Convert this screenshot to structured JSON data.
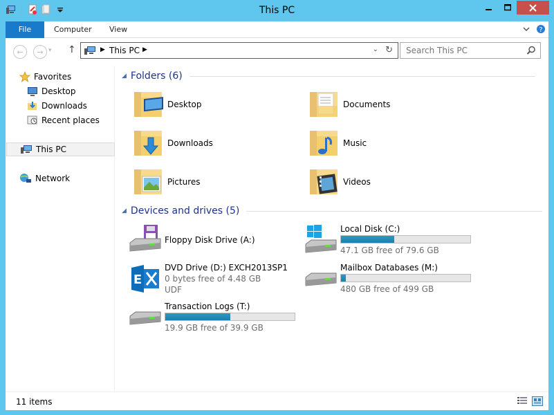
{
  "window": {
    "title": "This PC"
  },
  "ribbon": {
    "tabs": [
      "File",
      "Computer",
      "View"
    ]
  },
  "address": {
    "crumb": "This PC"
  },
  "search": {
    "placeholder": "Search This PC"
  },
  "nav": {
    "favorites": "Favorites",
    "items": [
      "Desktop",
      "Downloads",
      "Recent places"
    ],
    "this_pc": "This PC",
    "network": "Network"
  },
  "folders": {
    "header": "Folders (6)",
    "items": [
      {
        "name": "Desktop",
        "icon": "folder-desktop-icon"
      },
      {
        "name": "Documents",
        "icon": "folder-documents-icon"
      },
      {
        "name": "Downloads",
        "icon": "folder-downloads-icon"
      },
      {
        "name": "Music",
        "icon": "folder-music-icon"
      },
      {
        "name": "Pictures",
        "icon": "folder-pictures-icon"
      },
      {
        "name": "Videos",
        "icon": "folder-videos-icon"
      }
    ]
  },
  "drives": {
    "header": "Devices and drives (5)",
    "floppy": {
      "name": "Floppy Disk Drive (A:)"
    },
    "local": {
      "name": "Local Disk (C:)",
      "free": "47.1 GB free of 79.6 GB",
      "used_fraction": 0.41
    },
    "dvd": {
      "name": "DVD Drive (D:) EXCH2013SP1",
      "free": "0 bytes free of 4.48 GB",
      "fs": "UDF"
    },
    "mailbox": {
      "name": "Mailbox Databases (M:)",
      "free": "480 GB free of 499 GB",
      "used_fraction": 0.04
    },
    "logs": {
      "name": "Transaction Logs (T:)",
      "free": "19.9 GB free of 39.9 GB",
      "used_fraction": 0.5
    }
  },
  "status": {
    "count": "11 items"
  },
  "colors": {
    "titlebar": "#5fc6ee",
    "file_tab": "#1979ca",
    "close_btn": "#c7504c",
    "header_text": "#1e3287",
    "bar_fill": "#1b8ac0"
  }
}
